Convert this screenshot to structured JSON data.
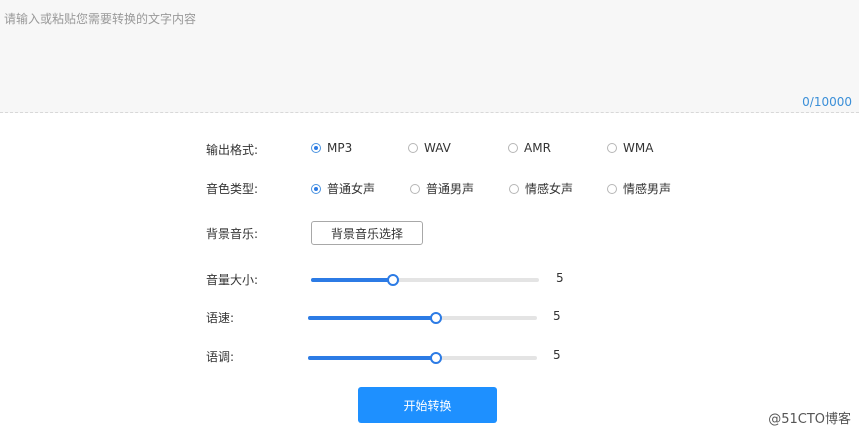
{
  "text_input": {
    "placeholder": "请输入或粘贴您需要转换的文字内容",
    "counter": "0/10000"
  },
  "format_row": {
    "label": "输出格式:",
    "options": [
      {
        "label": "MP3",
        "checked": true
      },
      {
        "label": "WAV",
        "checked": false
      },
      {
        "label": "AMR",
        "checked": false
      },
      {
        "label": "WMA",
        "checked": false
      }
    ]
  },
  "voice_row": {
    "label": "音色类型:",
    "options": [
      {
        "label": "普通女声",
        "checked": true
      },
      {
        "label": "普通男声",
        "checked": false
      },
      {
        "label": "情感女声",
        "checked": false
      },
      {
        "label": "情感男声",
        "checked": false
      }
    ]
  },
  "music_row": {
    "label": "背景音乐:",
    "button_label": "背景音乐选择"
  },
  "sliders": [
    {
      "label": "音量大小:",
      "value": "5",
      "level": 0.36
    },
    {
      "label": "语速:",
      "value": "5",
      "level": 0.56
    },
    {
      "label": "语调:",
      "value": "5",
      "level": 0.56
    }
  ],
  "start_button": {
    "label": "开始转换"
  },
  "watermark": "@51CTO博客",
  "colors": {
    "accent": "#2c7be5",
    "button": "#1e90ff",
    "counter": "#3b8fd8"
  }
}
